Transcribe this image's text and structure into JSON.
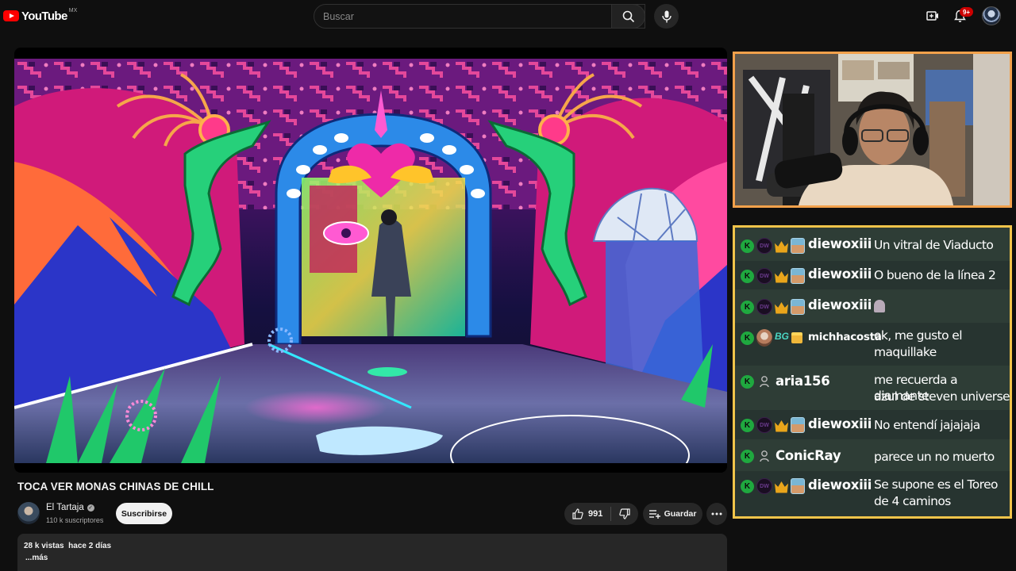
{
  "header": {
    "logo_text": "YouTube",
    "region": "MX",
    "search_placeholder": "Buscar",
    "notification_count": "9+"
  },
  "video": {
    "title": "TOCA VER MONAS CHINAS DE CHILL",
    "likes": "991",
    "save_label": "Guardar"
  },
  "channel": {
    "name": "El Tartaja",
    "subscribers": "110 k suscriptores",
    "subscribe_label": "Suscribirse"
  },
  "description": {
    "views": "28 k vistas",
    "date": "hace 2 días",
    "more_label": "...más"
  },
  "chat": {
    "badge_k": "K",
    "badge_dw": "DW",
    "badge_bg": "BG",
    "messages": [
      {
        "user": "diewoxiii",
        "text": "Un vitral de Viaducto"
      },
      {
        "user": "diewoxiii",
        "text": "O bueno de la línea 2"
      },
      {
        "user": "diewoxiii",
        "text": ""
      },
      {
        "user": "michhacosta",
        "line1": "ok, me gusto el",
        "line2": "maquillake"
      },
      {
        "user": "aria156",
        "line1": "me recuerda a diamante",
        "line2": "azul de steven universe"
      },
      {
        "user": "diewoxiii",
        "text": "No entendí jajajaja"
      },
      {
        "user": "ConicRay",
        "text": "parece un no muerto"
      },
      {
        "user": "diewoxiii",
        "line1": "Se supone es el Toreo",
        "line2": "de 4 caminos"
      }
    ]
  }
}
